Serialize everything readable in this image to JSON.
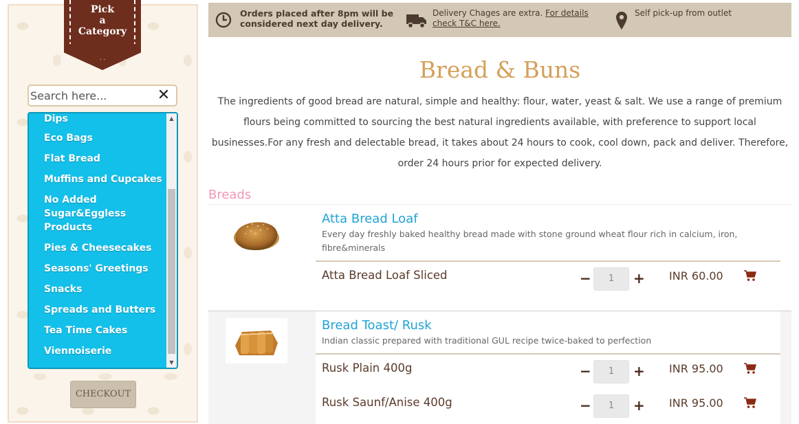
{
  "sidebar": {
    "ribbon_label": "Pick\na\nCategory",
    "search": {
      "placeholder": "Search here...",
      "value": ""
    },
    "categories": [
      "Dips",
      "Eco Bags",
      "Flat Bread",
      "Muffins and Cupcakes",
      "No Added\nSugar&Eggless\nProducts",
      "Pies & Cheesecakes",
      "Seasons' Greetings",
      "Snacks",
      "Spreads and Butters",
      "Tea Time Cakes",
      "Viennoiserie"
    ],
    "checkout_label": "CHECKOUT"
  },
  "info_bar": {
    "order_notice": "Orders placed after 8pm will be\nconsidered next day delivery.",
    "delivery_text": "Delivery Chages are extra. ",
    "delivery_link_1": "For details",
    "delivery_link_2": "check T&C here.",
    "pickup_text": "Self pick-up from outlet"
  },
  "main": {
    "title": "Bread & Buns",
    "intro": "The ingredients of good bread are natural, simple and healthy: flour, water, yeast & salt. We use a range of premium flours being committed to sourcing the best natural ingredients available, with preference to support local businesses.For any fresh and delectable bread, it takes about 24 hours to cook, cool down, pack and deliver. Therefore, order 24 hours prior for expected delivery.",
    "section_heading": "Breads",
    "products": [
      {
        "title": "Atta Bread Loaf",
        "description": "Every day freshly baked healthy bread made with stone ground wheat flour rich in calcium, iron, fibre&minerals",
        "variants": [
          {
            "name": "Atta Bread Loaf Sliced",
            "qty": "1",
            "price": "INR 60.00"
          }
        ]
      },
      {
        "title": "Bread Toast/ Rusk",
        "description": "Indian classic prepared with traditional GUL recipe twice-baked to perfection",
        "variants": [
          {
            "name": "Rusk Plain 400g",
            "qty": "1",
            "price": "INR 95.00"
          },
          {
            "name": "Rusk Saunf/Anise 400g",
            "qty": "1",
            "price": "INR 95.00"
          }
        ]
      }
    ]
  },
  "icons": {
    "clock": "clock-icon",
    "truck": "truck-icon",
    "pin": "map-pin-icon",
    "cart": "cart-icon",
    "close": "close-icon"
  },
  "colors": {
    "ribbon": "#6e2e1d",
    "category_bg": "#13c0ea",
    "title": "#d4a05a",
    "product_title": "#1fa3d6",
    "section_heading": "#f196b4",
    "info_bar": "#d3c7b5",
    "cart": "#8b2a12"
  }
}
